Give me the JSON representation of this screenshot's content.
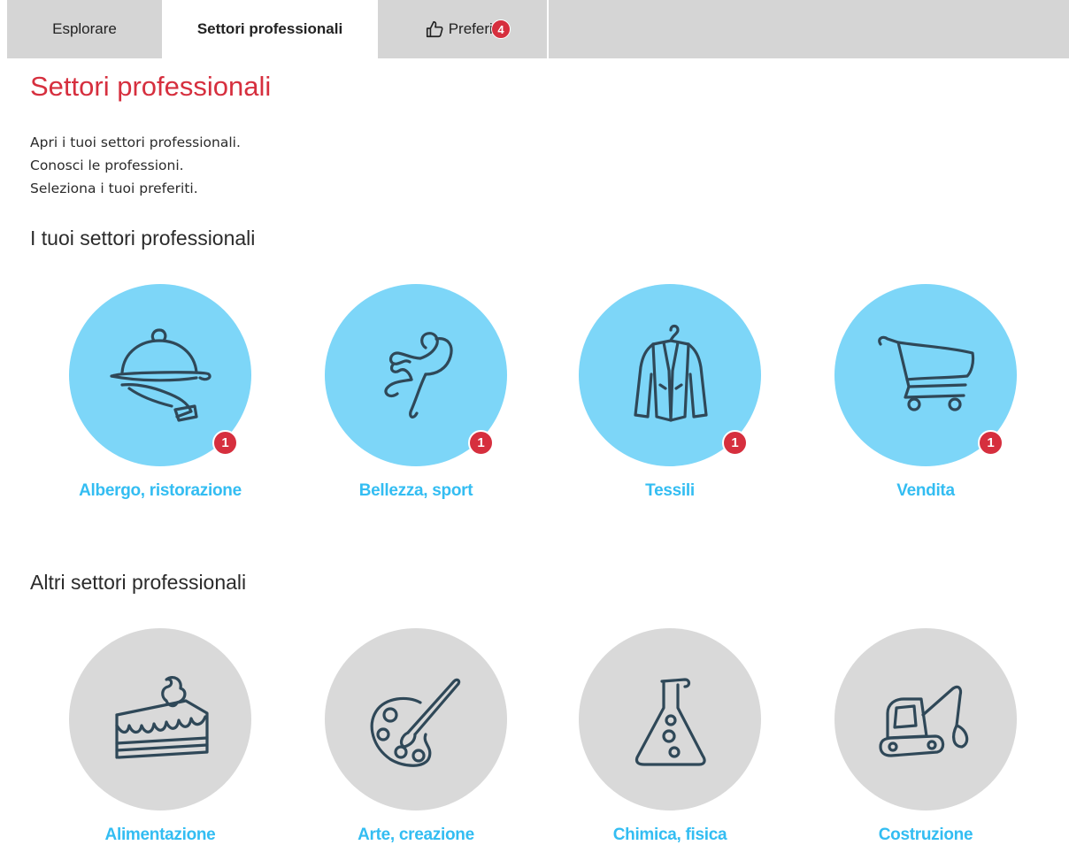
{
  "tabs": [
    {
      "label": "Esplorare"
    },
    {
      "label": "Settori professionali"
    },
    {
      "label": "Preferiti",
      "badge": "4"
    }
  ],
  "page_title": "Settori professionali",
  "intro": [
    "Apri i tuoi settori professionali.",
    "Conosci le professioni.",
    "Seleziona i tuoi preferiti."
  ],
  "my_sectors": {
    "heading": "I tuoi settori professionali",
    "items": [
      {
        "label": "Albergo, ristorazione",
        "badge": "1",
        "icon": "cloche-icon"
      },
      {
        "label": "Bellezza, sport",
        "badge": "1",
        "icon": "dancer-icon"
      },
      {
        "label": "Tessili",
        "badge": "1",
        "icon": "jacket-icon"
      },
      {
        "label": "Vendita",
        "badge": "1",
        "icon": "shopping-cart-icon"
      }
    ]
  },
  "other_sectors": {
    "heading": "Altri settori professionali",
    "items": [
      {
        "label": "Alimentazione",
        "icon": "cake-icon"
      },
      {
        "label": "Arte, creazione",
        "icon": "palette-icon"
      },
      {
        "label": "Chimica, fisica",
        "icon": "flask-icon"
      },
      {
        "label": "Costruzione",
        "icon": "excavator-icon"
      }
    ]
  },
  "colors": {
    "accent_red": "#d62f3e",
    "label_blue": "#33bdf2",
    "favorite_circle": "#7dd6f8",
    "neutral_circle": "#d9d9d9",
    "tab_bg": "#d5d5d5"
  }
}
